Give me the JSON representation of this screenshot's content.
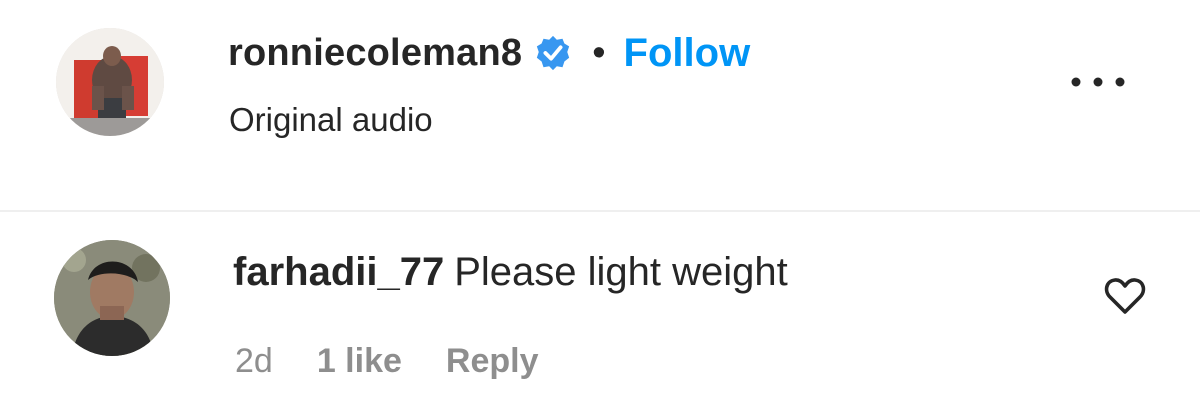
{
  "post": {
    "username": "ronniecoleman8",
    "verified_icon": "verified-badge-icon",
    "separator": "•",
    "follow_label": "Follow",
    "audio_label": "Original audio",
    "more_icon": "more-options-icon"
  },
  "comment": {
    "username": "farhadii_77",
    "text": "Please light weight",
    "age": "2d",
    "likes": "1 like",
    "reply_label": "Reply",
    "like_icon": "heart-icon"
  },
  "colors": {
    "follow": "#0095f6",
    "verified": "#3897f0",
    "meta": "#8e8e8e",
    "text": "#262626"
  }
}
